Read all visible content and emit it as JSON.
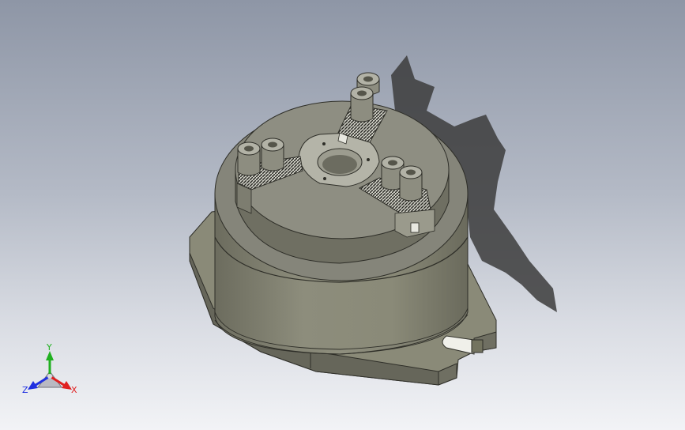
{
  "viewport": {
    "background_top": "#8e96a6",
    "background_bottom": "#f2f3f6"
  },
  "model": {
    "body_color": "#8a8a78",
    "body_dark": "#5f5f52",
    "body_light": "#a8a896",
    "shadow_color": "#3c3c3c",
    "components": [
      "base-flange",
      "chuck-body",
      "chuck-face",
      "center-bore",
      "jaw-top",
      "jaw-left",
      "jaw-right",
      "cap-screws",
      "mounting-slot"
    ]
  },
  "triad": {
    "x_label": "X",
    "y_label": "Y",
    "z_label": "Z",
    "x_color": "#e02020",
    "y_color": "#20b020",
    "z_color": "#2030e0"
  }
}
